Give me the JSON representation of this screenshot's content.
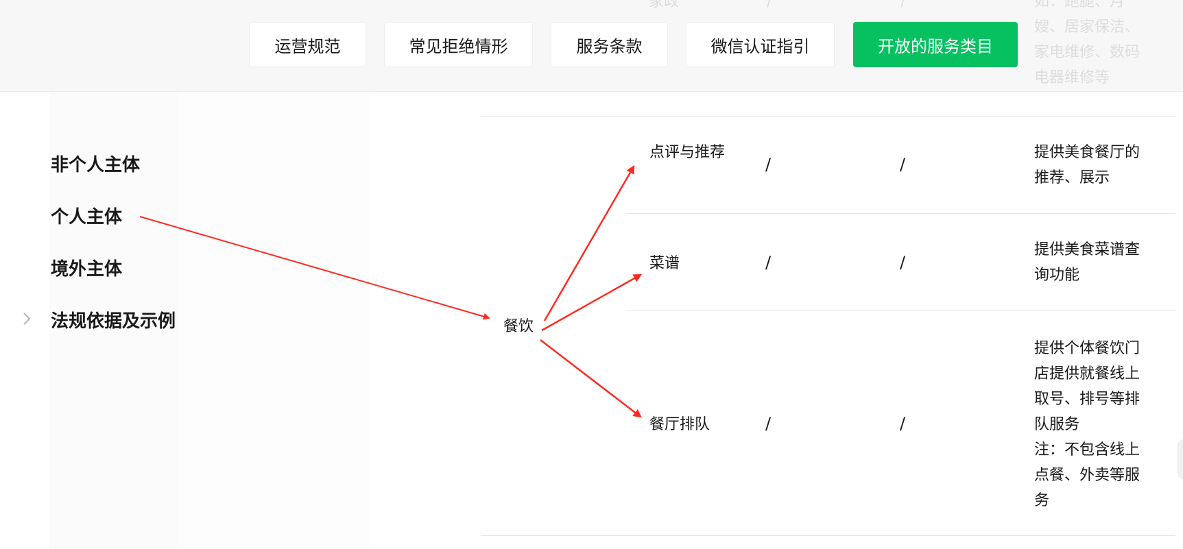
{
  "nav": {
    "buttons": [
      {
        "label": "运营规范",
        "active": false
      },
      {
        "label": "常见拒绝情形",
        "active": false
      },
      {
        "label": "服务条款",
        "active": false
      },
      {
        "label": "微信认证指引",
        "active": false
      },
      {
        "label": "开放的服务类目",
        "active": true
      }
    ],
    "accent_color": "#07c160"
  },
  "sidebar": {
    "items": [
      {
        "label": "非个人主体"
      },
      {
        "label": "个人主体"
      },
      {
        "label": "境外主体"
      },
      {
        "label": "法规依据及示例"
      }
    ],
    "expand_icon": "chevron-right-icon"
  },
  "table": {
    "category": "餐饮",
    "rows": [
      {
        "sub": "点评与推荐",
        "col1": "/",
        "col2": "/",
        "desc": "提供美食餐厅的推荐、展示"
      },
      {
        "sub": "菜谱",
        "col1": "/",
        "col2": "/",
        "desc": "提供美食菜谱查询功能"
      },
      {
        "sub": "餐厅排队",
        "col1": "/",
        "col2": "/",
        "desc": "提供个体餐饮门店提供就餐线上取号、排号等排队服务\n注：不包含线上点餐、外卖等服务"
      }
    ],
    "faded_previous_row": {
      "col0": "家政",
      "col1": "/",
      "col2": "/",
      "desc": "如：跑腿、月嫂、居家保洁、家电维修、数码电器维修等"
    }
  },
  "annotation": {
    "arrow_color": "#ff2a1f"
  }
}
